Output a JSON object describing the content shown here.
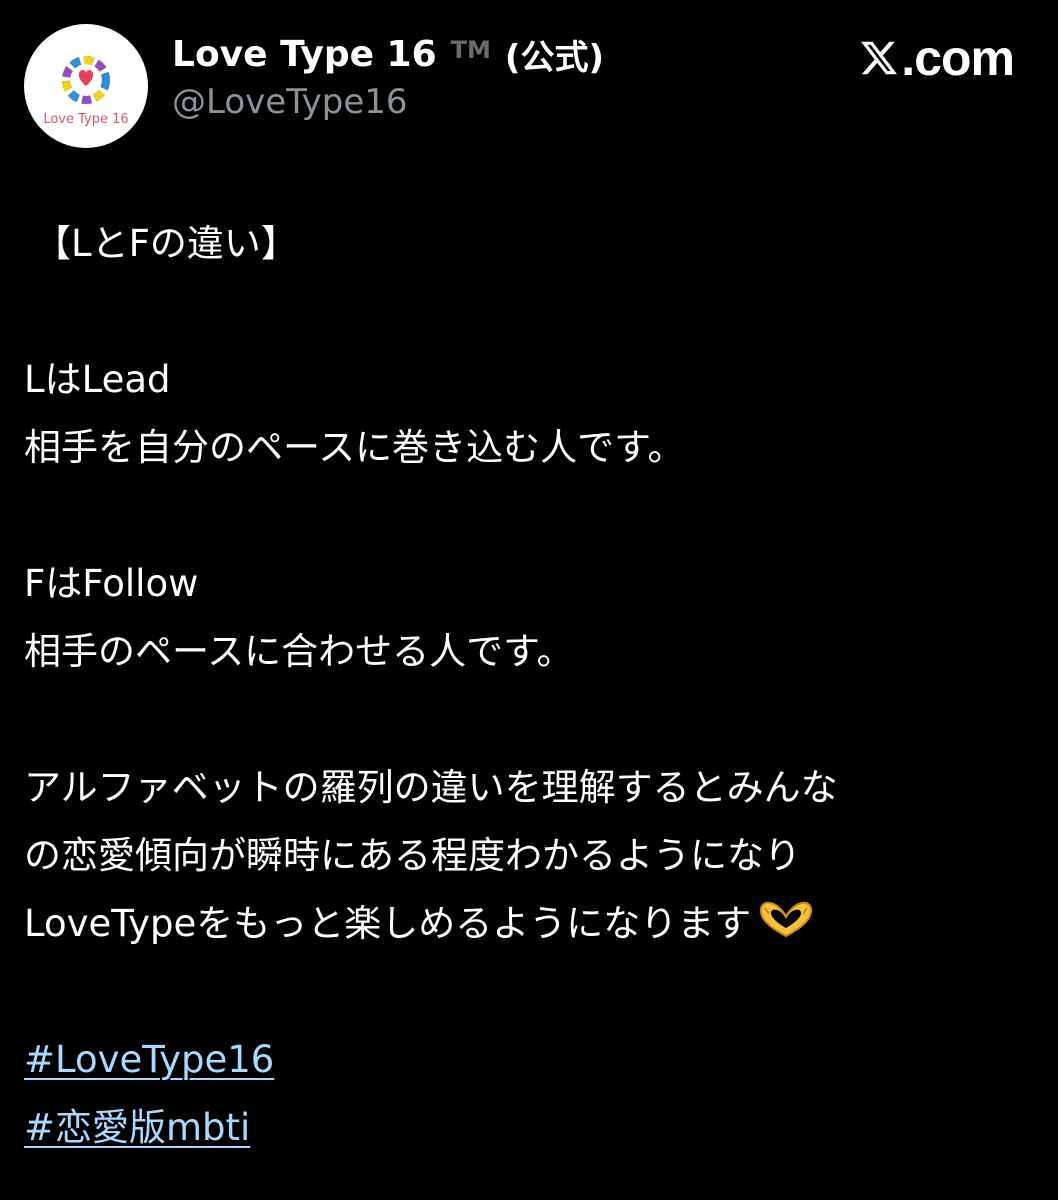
{
  "account": {
    "display_name": "Love Type 16",
    "trademark": "TM",
    "official_label": "(公式)",
    "handle": "@LoveType16",
    "avatar_text": "Love Type 16",
    "avatar_icon": "rainbow-heart-icon"
  },
  "brand": {
    "logo_icon": "x-logo-icon",
    "text": ".com"
  },
  "post": {
    "title": "【LとFの違い】",
    "l_heading": "LはLead",
    "l_description": "相手を自分のペースに巻き込む人です。",
    "f_heading": "FはFollow",
    "f_description": "相手のペースに合わせる人です。",
    "paragraph_line1": "アルファベットの羅列の違いを理解するとみんな",
    "paragraph_line2": "の恋愛傾向が瞬時にある程度わかるようになり",
    "paragraph_line3": "LoveTypeをもっと楽しめるようになります",
    "paragraph_emoji": "heart-hands-emoji",
    "hashtags": [
      "#LoveType16",
      "#恋愛版mbti"
    ]
  },
  "colors": {
    "background": "#000000",
    "text": "#ffffff",
    "handle": "#8b9298",
    "hashtag": "#a8d8ff",
    "avatar_text": "#d6566e"
  }
}
